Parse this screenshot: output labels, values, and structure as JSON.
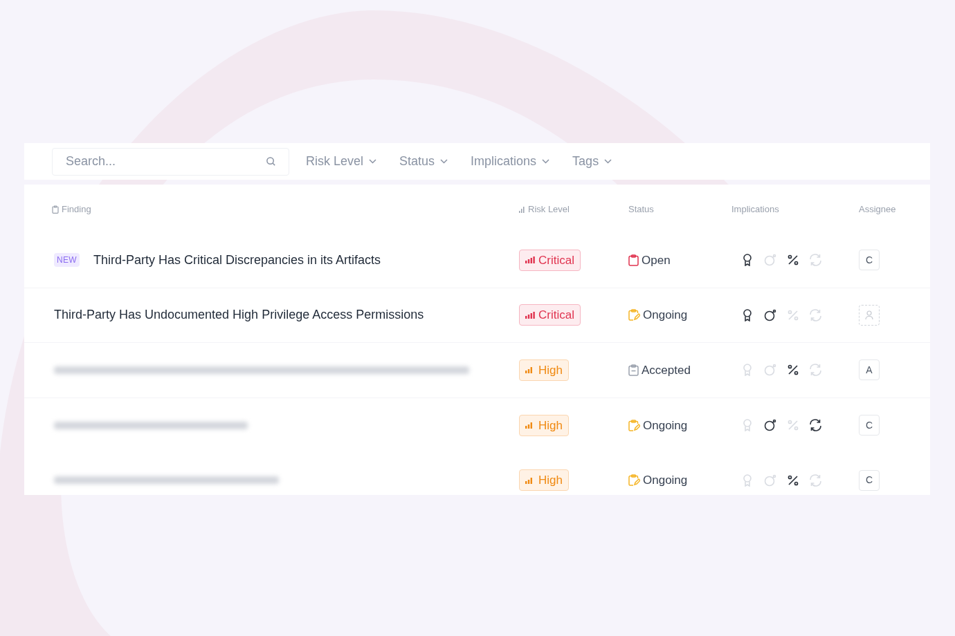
{
  "filters": {
    "search": {
      "placeholder": "Search..."
    },
    "dropdowns": [
      "Risk Level",
      "Status",
      "Implications",
      "Tags"
    ]
  },
  "table": {
    "columns": [
      {
        "label": "Finding",
        "kind": "finding"
      },
      {
        "label": "Risk Level",
        "kind": "risk"
      },
      {
        "label": "Status",
        "kind": "plain"
      },
      {
        "label": "Implications",
        "kind": "plain"
      },
      {
        "label": "Assignee",
        "kind": "plain"
      }
    ],
    "rows": [
      {
        "blurred": false,
        "badge": "NEW",
        "finding": "Third-Party Has Critical Discrepancies in its Artifacts",
        "risk": {
          "kind": "critical",
          "label": "Critical"
        },
        "status": {
          "kind": "open",
          "label": "Open"
        },
        "implications": [
          {
            "kind": "award",
            "on": true
          },
          {
            "kind": "bomb",
            "on": false
          },
          {
            "kind": "percent",
            "on": true
          },
          {
            "kind": "refresh",
            "on": false
          }
        ],
        "assignee": {
          "kind": "initial",
          "label": "C"
        }
      },
      {
        "blurred": false,
        "finding": "Third-Party Has Undocumented High Privilege Access Permissions",
        "risk": {
          "kind": "critical",
          "label": "Critical"
        },
        "status": {
          "kind": "ongoing",
          "label": "Ongoing"
        },
        "implications": [
          {
            "kind": "award",
            "on": true
          },
          {
            "kind": "bomb",
            "on": true
          },
          {
            "kind": "percent",
            "on": false
          },
          {
            "kind": "refresh",
            "on": false
          }
        ],
        "assignee": {
          "kind": "empty"
        }
      },
      {
        "blurred": true,
        "risk": {
          "kind": "high",
          "label": "High"
        },
        "status": {
          "kind": "accepted",
          "label": "Accepted"
        },
        "implications": [
          {
            "kind": "award",
            "on": false
          },
          {
            "kind": "bomb",
            "on": false
          },
          {
            "kind": "percent",
            "on": true
          },
          {
            "kind": "refresh",
            "on": false
          }
        ],
        "assignee": {
          "kind": "initial",
          "label": "A"
        }
      },
      {
        "blurred": true,
        "risk": {
          "kind": "high",
          "label": "High"
        },
        "status": {
          "kind": "ongoing",
          "label": "Ongoing"
        },
        "implications": [
          {
            "kind": "award",
            "on": false
          },
          {
            "kind": "bomb",
            "on": true
          },
          {
            "kind": "percent",
            "on": false
          },
          {
            "kind": "refresh",
            "on": true
          }
        ],
        "assignee": {
          "kind": "initial",
          "label": "C"
        }
      },
      {
        "blurred": true,
        "risk": {
          "kind": "high",
          "label": "High"
        },
        "status": {
          "kind": "ongoing",
          "label": "Ongoing"
        },
        "implications": [
          {
            "kind": "award",
            "on": false
          },
          {
            "kind": "bomb",
            "on": false
          },
          {
            "kind": "percent",
            "on": true
          },
          {
            "kind": "refresh",
            "on": false
          }
        ],
        "assignee": {
          "kind": "initial",
          "label": "C"
        }
      }
    ]
  }
}
